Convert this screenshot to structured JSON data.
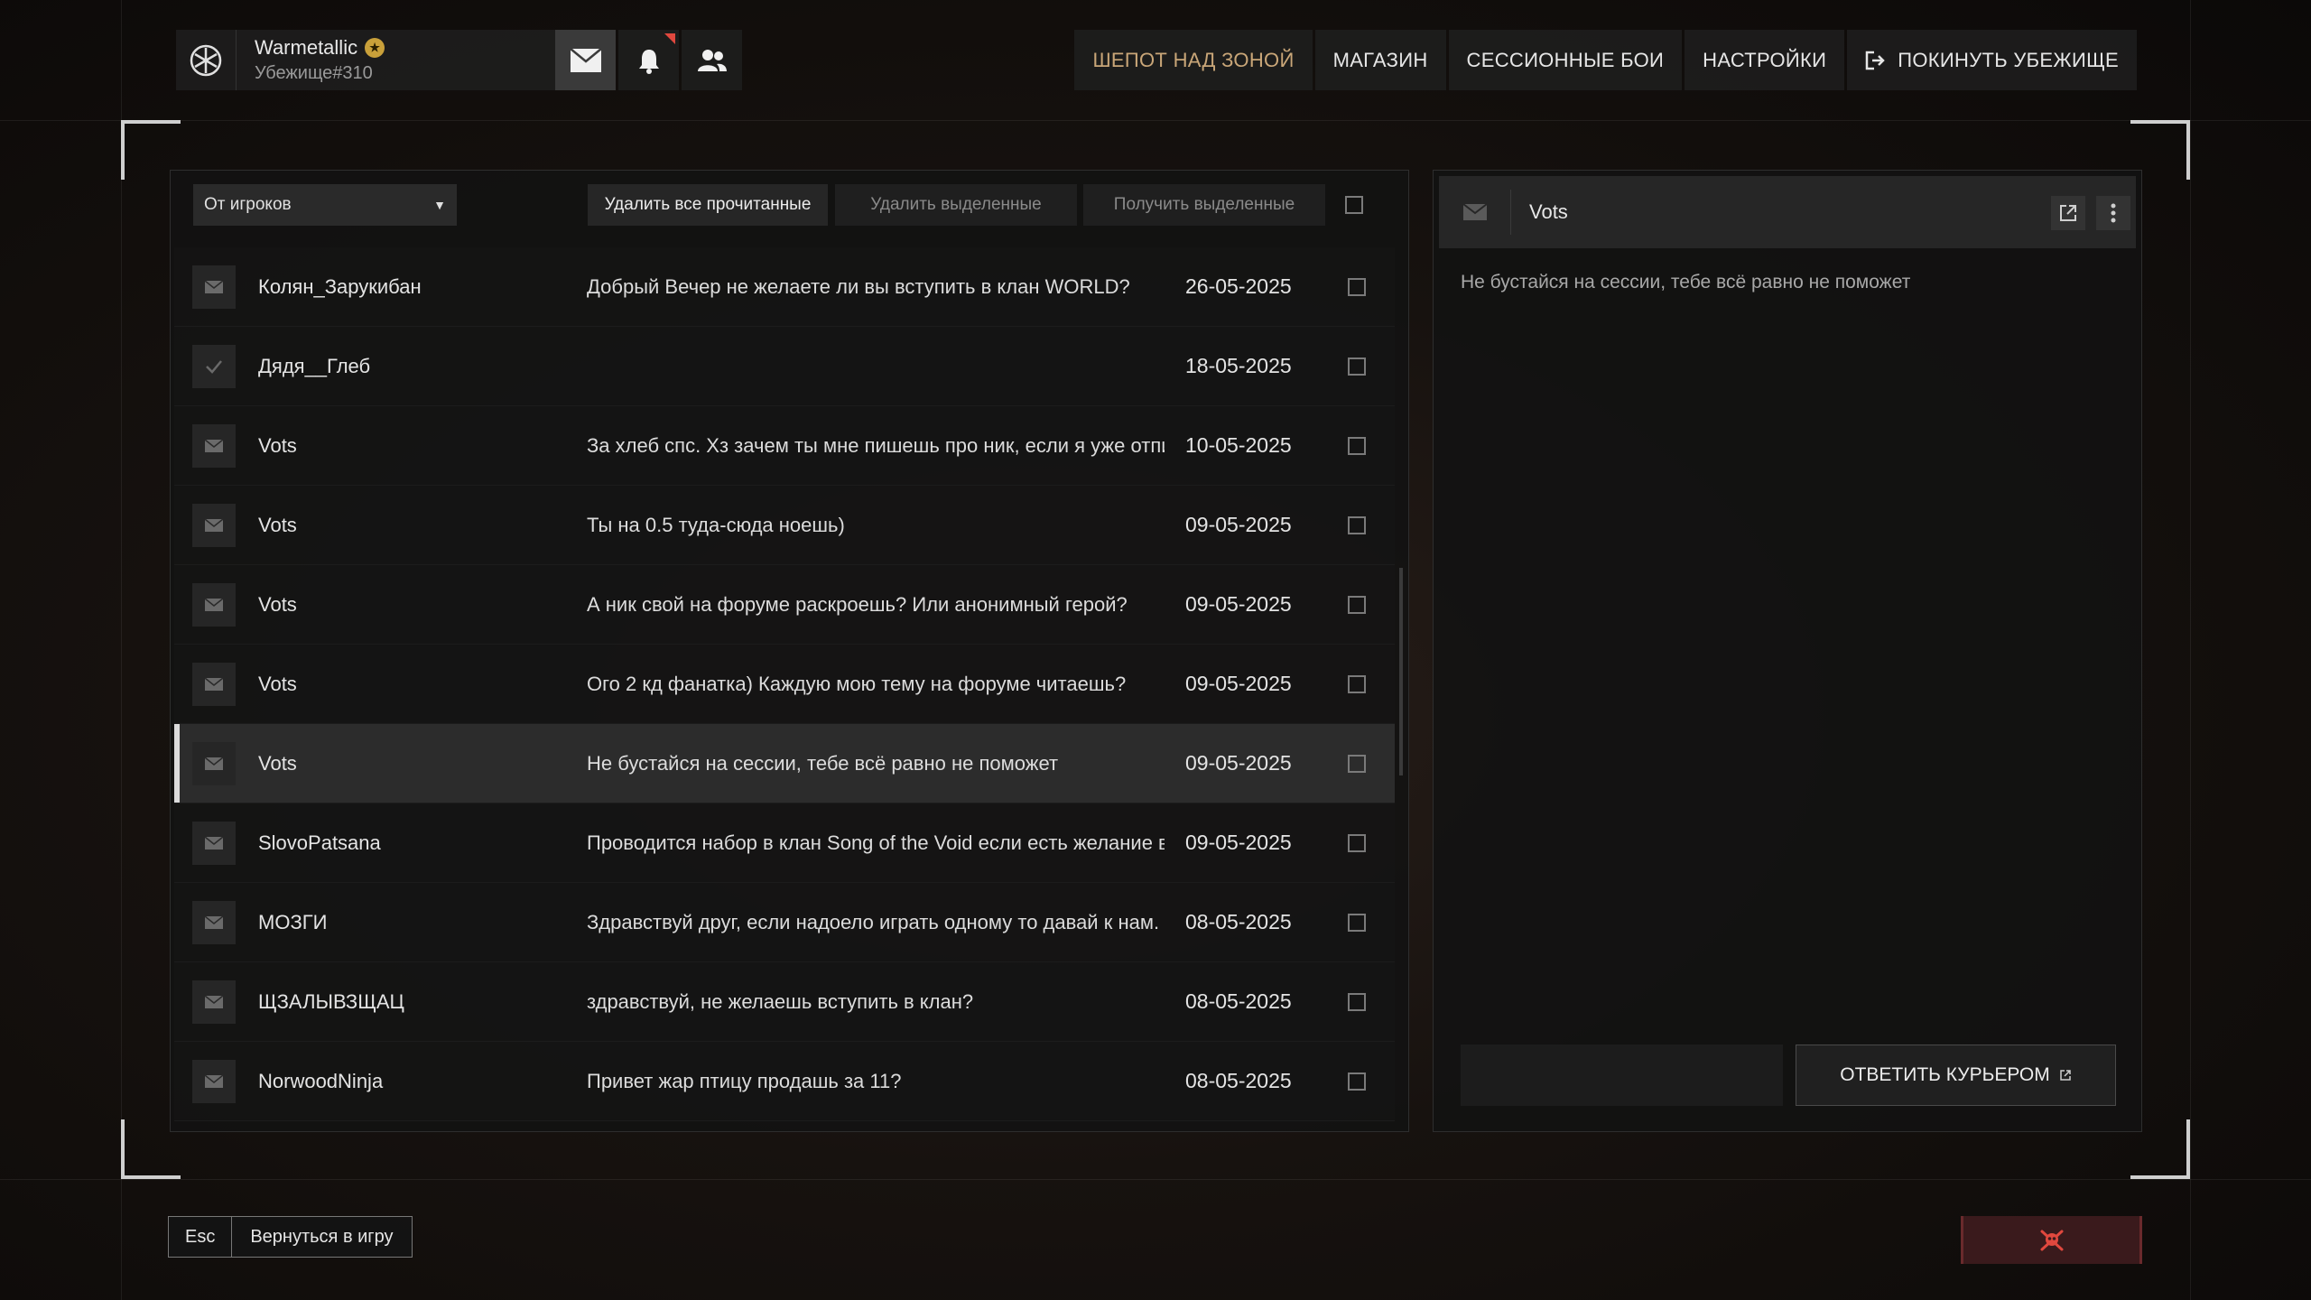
{
  "profile": {
    "name": "Warmetallic",
    "shelter": "Убежище#310"
  },
  "nav": [
    {
      "label": "ШЕПОТ НАД ЗОНОЙ",
      "active": true
    },
    {
      "label": "МАГАЗИН",
      "active": false
    },
    {
      "label": "СЕССИОННЫЕ БОИ",
      "active": false
    },
    {
      "label": "НАСТРОЙКИ",
      "active": false
    },
    {
      "label": "ПОКИНУТЬ УБЕЖИЩЕ",
      "active": false
    }
  ],
  "toolbar": {
    "filter": "От игроков",
    "delete_read": "Удалить все прочитанные",
    "delete_selected": "Удалить выделенные",
    "get_selected": "Получить выделенные"
  },
  "messages": [
    {
      "icon": "envelope-icon",
      "sender": "Колян_Зарукибан",
      "subject": "Добрый Вечер не желаете ли вы вступить в клан WORLD?",
      "date": "26-05-2025",
      "selected": false
    },
    {
      "icon": "check-icon",
      "sender": "Дядя__Глеб",
      "subject": "",
      "date": "18-05-2025",
      "selected": false
    },
    {
      "icon": "envelope-icon",
      "sender": "Vots",
      "subject": "За хлеб спс. Хз зачем ты мне пишешь про ник, если я уже отпи..",
      "date": "10-05-2025",
      "selected": false
    },
    {
      "icon": "envelope-icon",
      "sender": "Vots",
      "subject": "Ты на 0.5 туда-сюда ноешь)",
      "date": "09-05-2025",
      "selected": false
    },
    {
      "icon": "envelope-icon",
      "sender": "Vots",
      "subject": "А ник свой на форуме раскроешь? Или анонимный герой?",
      "date": "09-05-2025",
      "selected": false
    },
    {
      "icon": "envelope-icon",
      "sender": "Vots",
      "subject": "Ого 2 кд фанатка) Каждую мою тему на форуме читаешь?",
      "date": "09-05-2025",
      "selected": false
    },
    {
      "icon": "envelope-icon",
      "sender": "Vots",
      "subject": "Не бустайся на сессии, тебе всё равно не поможет",
      "date": "09-05-2025",
      "selected": true
    },
    {
      "icon": "envelope-icon",
      "sender": "SlovoPatsana",
      "subject": "Проводится набор в клан Song of the Void если есть желание вс..",
      "date": "09-05-2025",
      "selected": false
    },
    {
      "icon": "envelope-icon",
      "sender": "МОЗГИ",
      "subject": "Здравствуй друг, если надоело играть одному то давай к нам.",
      "date": "08-05-2025",
      "selected": false
    },
    {
      "icon": "envelope-icon",
      "sender": "ЩЗАЛЫВЗЩАЦ",
      "subject": "здравствуй, не желаешь вступить в клан?",
      "date": "08-05-2025",
      "selected": false
    },
    {
      "icon": "envelope-icon",
      "sender": "NorwoodNinja",
      "subject": "Привет жар птицу продашь за 11?",
      "date": "08-05-2025",
      "selected": false
    }
  ],
  "detail": {
    "sender": "Vots",
    "body": "Не бустайся на сессии, тебе всё равно не поможет",
    "reply_label": "ОТВЕТИТЬ КУРЬЕРОМ"
  },
  "footer": {
    "key": "Esc",
    "back_label": "Вернуться в игру"
  },
  "colors": {
    "accent": "#c9a678",
    "notification": "#e0483e",
    "danger": "#e0483e"
  }
}
